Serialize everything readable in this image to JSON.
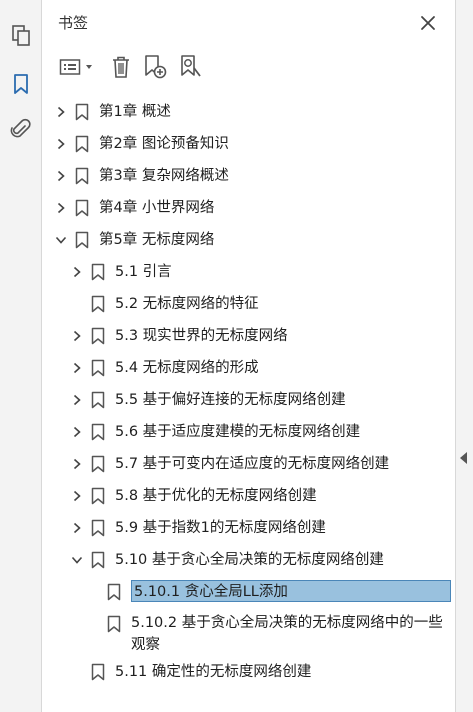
{
  "panel": {
    "title": "书签",
    "close_icon": "close-icon"
  },
  "rail": {
    "icons": [
      "pages-icon",
      "bookmark-icon",
      "attachment-icon"
    ],
    "active": "bookmark-icon"
  },
  "toolbar": {
    "icons": [
      "options-menu-icon",
      "chevron-down-icon",
      "delete-bookmark-icon",
      "new-bookmark-icon",
      "bookmark-search-icon"
    ]
  },
  "colors": {
    "selected_bg": "#99c1de",
    "selected_border": "#4a86b8",
    "icon": "#555555",
    "active_icon": "#2b6cb0"
  },
  "bookmarks": [
    {
      "label": "第1章 概述",
      "level": 0,
      "state": "collapsed"
    },
    {
      "label": "第2章 图论预备知识",
      "level": 0,
      "state": "collapsed"
    },
    {
      "label": "第3章 复杂网络概述",
      "level": 0,
      "state": "collapsed"
    },
    {
      "label": "第4章 小世界网络",
      "level": 0,
      "state": "collapsed"
    },
    {
      "label": "第5章 无标度网络",
      "level": 0,
      "state": "expanded"
    },
    {
      "label": "5.1 引言",
      "level": 1,
      "state": "collapsed"
    },
    {
      "label": "5.2 无标度网络的特征",
      "level": 1,
      "state": "leaf"
    },
    {
      "label": "5.3 现实世界的无标度网络",
      "level": 1,
      "state": "collapsed"
    },
    {
      "label": "5.4 无标度网络的形成",
      "level": 1,
      "state": "collapsed"
    },
    {
      "label": "5.5 基于偏好连接的无标度网络创建",
      "level": 1,
      "state": "collapsed"
    },
    {
      "label": "5.6 基于适应度建模的无标度网络创建",
      "level": 1,
      "state": "collapsed"
    },
    {
      "label": "5.7 基于可变内在适应度的无标度网络创建",
      "level": 1,
      "state": "collapsed"
    },
    {
      "label": "5.8 基于优化的无标度网络创建",
      "level": 1,
      "state": "collapsed"
    },
    {
      "label": "5.9 基于指数1的无标度网络创建",
      "level": 1,
      "state": "collapsed"
    },
    {
      "label": "5.10 基于贪心全局决策的无标度网络创建",
      "level": 1,
      "state": "expanded"
    },
    {
      "label": "5.10.1 贪心全局LL添加",
      "level": 2,
      "state": "leaf",
      "selected": true
    },
    {
      "label": "5.10.2 基于贪心全局决策的无标度网络中的一些观察",
      "level": 2,
      "state": "leaf"
    },
    {
      "label": "5.11 确定性的无标度网络创建",
      "level": 1,
      "state": "leaf"
    }
  ]
}
